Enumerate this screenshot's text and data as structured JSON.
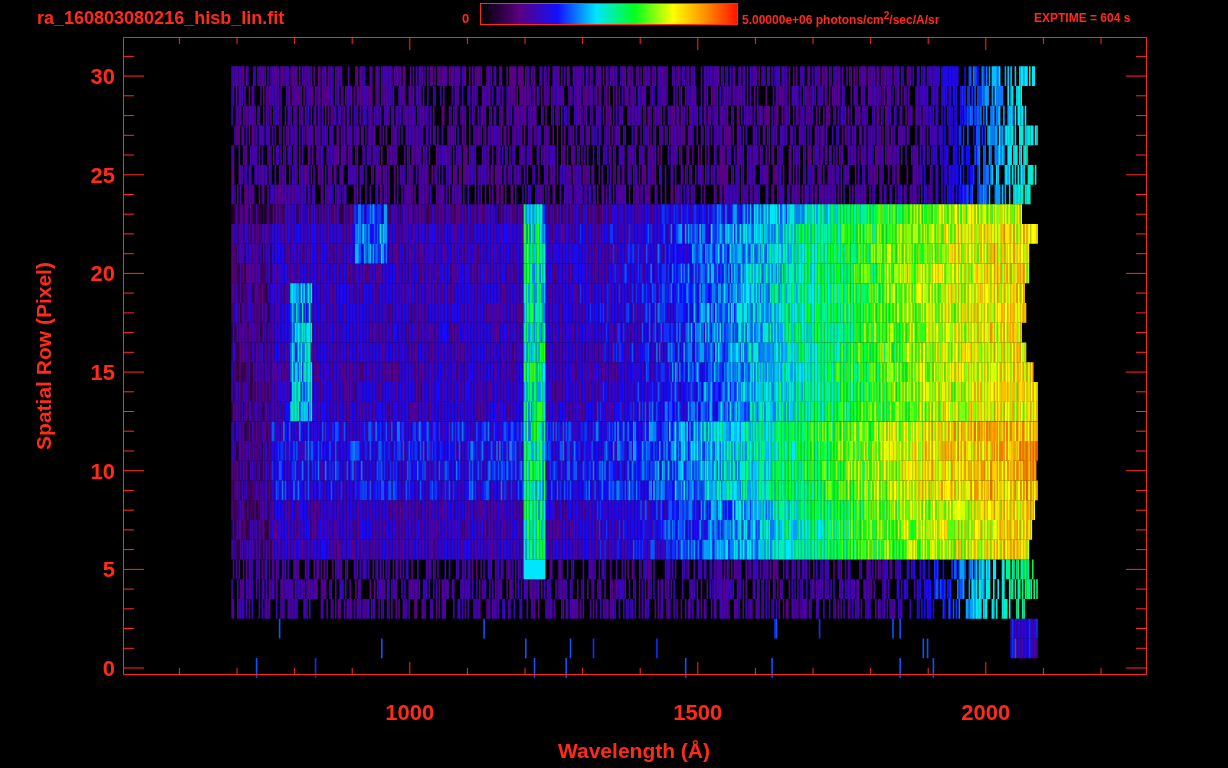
{
  "title": "ra_160803080216_hisb_lin.fit",
  "colorbar": {
    "min_label": "0",
    "max_label": "5.00000e+06 photons/cm$^{2}$/sec/A/sr"
  },
  "exptime": "EXPTIME = 604 s",
  "plot": {
    "xlabel": "Wavelength (Å)",
    "ylabel": "Spatial Row (Pixel)",
    "xtick_labels": [
      "1000",
      "1500",
      "2000"
    ],
    "ytick_labels": [
      "30",
      "25",
      "20",
      "15",
      "10",
      "5",
      "0"
    ]
  }
}
